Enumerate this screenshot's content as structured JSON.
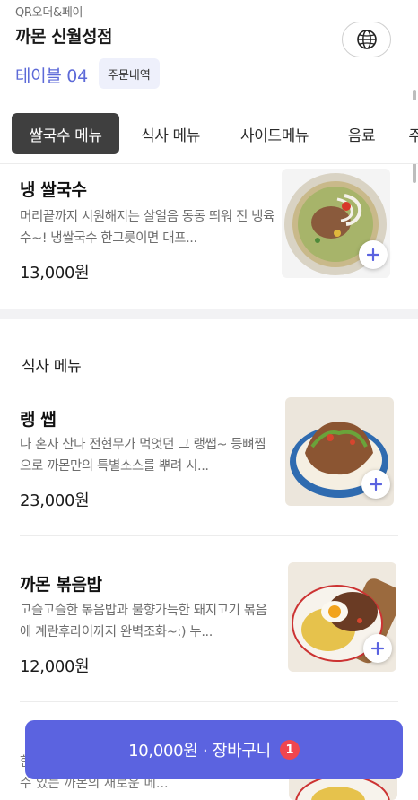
{
  "header": {
    "brand": "QR오더&페이",
    "store_name": "까몬 신월성점",
    "table_label": "테이블 04",
    "order_history_label": "주문내역",
    "language_icon": "globe-icon"
  },
  "tabs": [
    {
      "label": "쌀국수 메뉴",
      "active": true
    },
    {
      "label": "식사 메뉴",
      "active": false
    },
    {
      "label": "사이드메뉴",
      "active": false
    },
    {
      "label": "음료",
      "active": false
    },
    {
      "label": "주",
      "active": false
    }
  ],
  "sections": [
    {
      "items": [
        {
          "name": "냉 쌀국수",
          "desc": "머리끝까지 시원해지는 살얼음 동동 띄워 진 냉육수~! 냉쌀국수 한그릇이면 대프...",
          "price": "13,000원"
        }
      ]
    },
    {
      "title": "식사 메뉴",
      "items": [
        {
          "name": "랭 쌥",
          "desc": "나 혼자 산다 전현무가 먹엇던 그 랭쌥~ 등뼈찜으로 까몬만의 특별소스를 뿌려 시...",
          "price": "23,000원"
        },
        {
          "name": "까몬 볶음밥",
          "desc": "고슬고슬한 볶음밥과 불향가득한 돼지고기 볶음에 계란후라이까지 완벽조화~:) 누...",
          "price": "12,000원"
        },
        {
          "desc": "한 숟가락 가득 퍼서 먹는 볶음밥과 함께 즐길 수 있는 까몬의 새로운 메..."
        }
      ]
    }
  ],
  "cart": {
    "label": "10,000원 · 장바구니",
    "count": "1"
  },
  "colors": {
    "accent": "#5b63e0",
    "table_text": "#5d6ad8",
    "badge": "#f0464f",
    "active_tab": "#3f3f3f"
  }
}
